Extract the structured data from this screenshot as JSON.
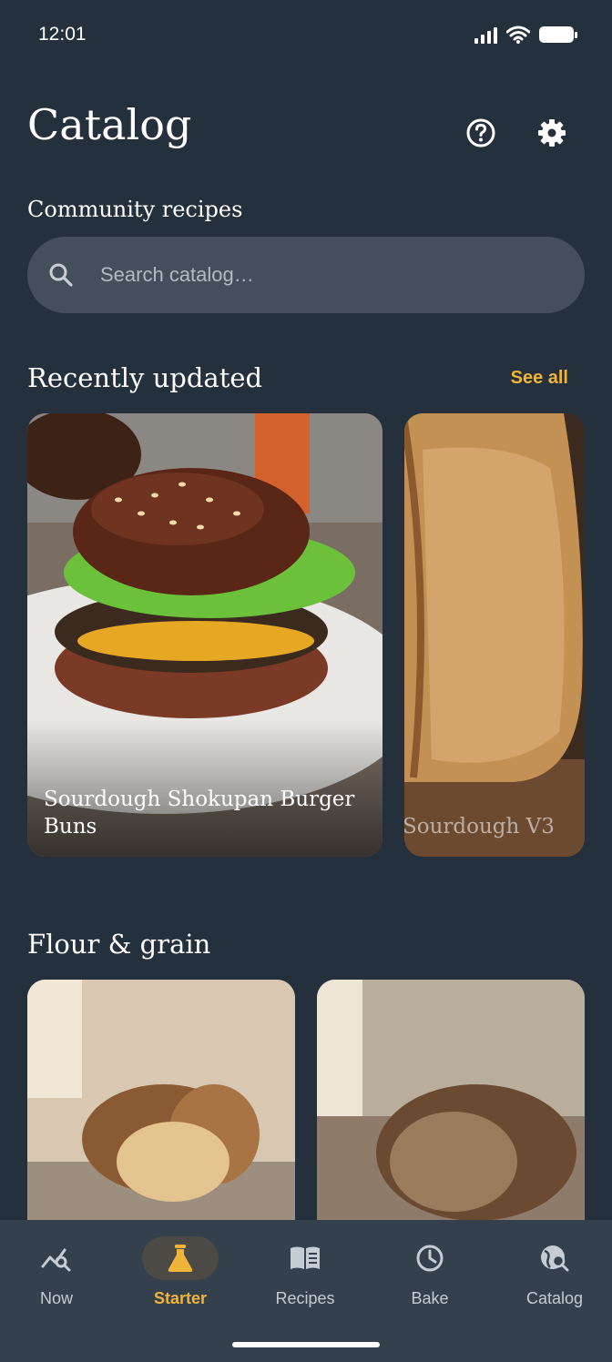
{
  "status_bar": {
    "time": "12:01"
  },
  "header": {
    "title": "Catalog",
    "help_icon": "help-circle-icon",
    "settings_icon": "gear-icon"
  },
  "community": {
    "label": "Community recipes"
  },
  "search": {
    "placeholder": "Search catalog…",
    "value": ""
  },
  "recently_updated": {
    "title": "Recently updated",
    "see_all": "See all",
    "cards": [
      {
        "title": "Sourdough Shokupan Burger Buns"
      },
      {
        "title": "Sourdough V3"
      }
    ]
  },
  "flour_grain": {
    "title": "Flour & grain"
  },
  "nav": {
    "items": [
      {
        "label": "Now",
        "icon": "chart-search-icon",
        "active": false
      },
      {
        "label": "Starter",
        "icon": "flask-icon",
        "active": true
      },
      {
        "label": "Recipes",
        "icon": "book-icon",
        "active": false
      },
      {
        "label": "Bake",
        "icon": "clock-icon",
        "active": false
      },
      {
        "label": "Catalog",
        "icon": "globe-search-icon",
        "active": false
      }
    ]
  },
  "colors": {
    "background": "#24303c",
    "accent": "#f1b43a",
    "nav_bg": "#34404c",
    "search_bg": "#444f5b"
  }
}
